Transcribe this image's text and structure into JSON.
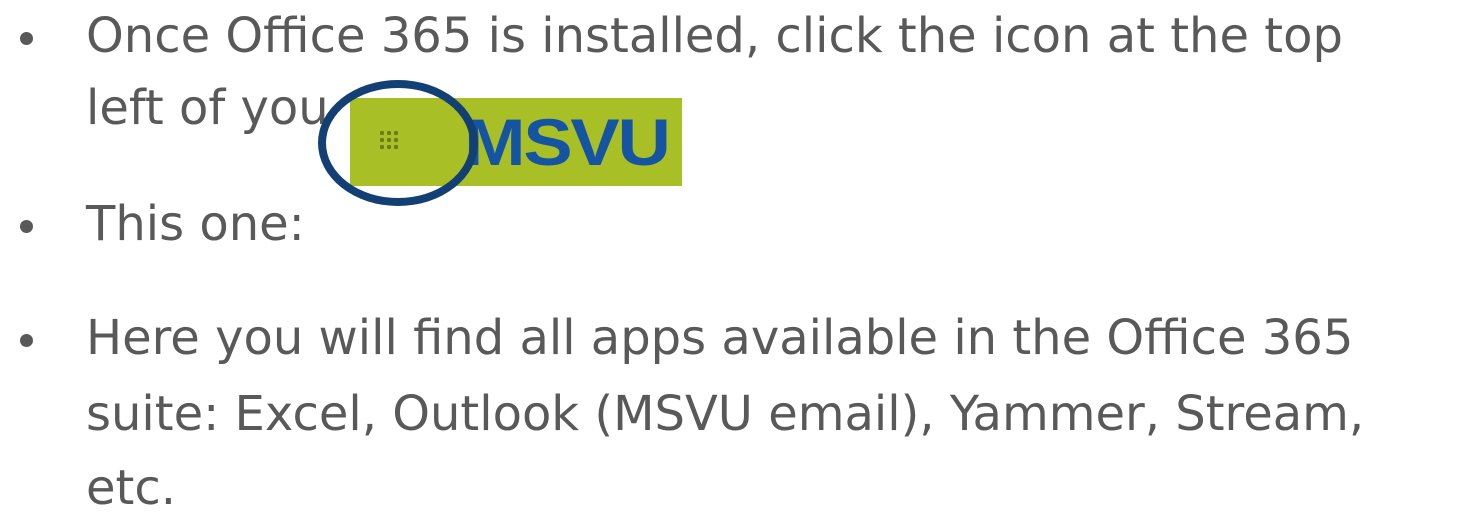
{
  "bullets": [
    {
      "lines": [
        "Once Office 365 is installed, click the icon at the top",
        "left of you"
      ]
    },
    {
      "lines": [
        "This one:"
      ]
    },
    {
      "lines": [
        "Here you will find all apps available in the Office 365",
        "suite: Excel, Outlook (MSVU email), Yammer, Stream,",
        "etc."
      ]
    }
  ],
  "launcher_image": {
    "logo_text": "MSVU",
    "icon": "app-launcher-waffle-icon",
    "background_color": "#a8bf25",
    "logo_color": "#1554a3",
    "highlight_color": "#123f74"
  }
}
